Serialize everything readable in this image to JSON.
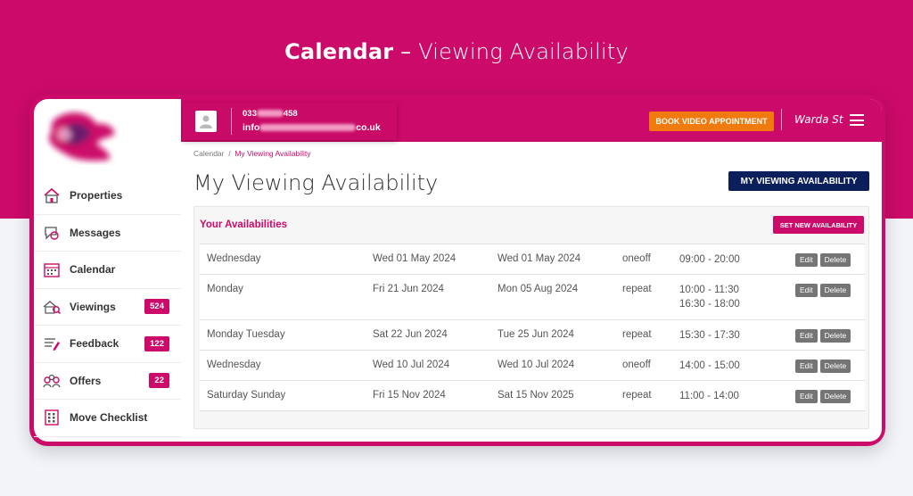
{
  "hero": {
    "title_bold": "Calendar",
    "title_sep": " – ",
    "title_light": "Viewing Availability"
  },
  "colors": {
    "brand": "#cc0a69",
    "navy": "#0b1f5c",
    "orange": "#f07a0c",
    "action_grey": "#757575"
  },
  "sidebar": {
    "items": [
      {
        "label": "Properties",
        "icon": "properties-icon",
        "badge": null
      },
      {
        "label": "Messages",
        "icon": "messages-icon",
        "badge": null
      },
      {
        "label": "Calendar",
        "icon": "calendar-icon",
        "badge": null
      },
      {
        "label": "Viewings",
        "icon": "viewings-icon",
        "badge": "524"
      },
      {
        "label": "Feedback",
        "icon": "feedback-icon",
        "badge": "122"
      },
      {
        "label": "Offers",
        "icon": "offers-icon",
        "badge": "22"
      },
      {
        "label": "Move Checklist",
        "icon": "checklist-icon",
        "badge": null
      }
    ]
  },
  "topbar": {
    "phone_prefix": "033",
    "phone_suffix": "458",
    "email_prefix": "info",
    "email_suffix": "co.uk",
    "book_button": "BOOK VIDEO APPOINTMENT",
    "user_name": "Warda St"
  },
  "breadcrumb": {
    "root": "Calendar",
    "sep": "/",
    "current": "My Viewing Availability"
  },
  "page": {
    "title": "My Viewing Availability",
    "header_button": "MY VIEWING AVAILABILITY"
  },
  "panel": {
    "title": "Your Availabilities",
    "set_button": "SET NEW AVAILABILITY"
  },
  "actions": {
    "edit": "Edit",
    "delete": "Delete"
  },
  "availabilities": [
    {
      "days": "Wednesday",
      "from": "Wed 01 May 2024",
      "to": "Wed 01 May 2024",
      "type": "oneoff",
      "times": [
        "09:00 - 20:00"
      ]
    },
    {
      "days": "Monday",
      "from": "Fri 21 Jun 2024",
      "to": "Mon 05 Aug 2024",
      "type": "repeat",
      "times": [
        "10:00 - 11:30",
        "16:30 - 18:00"
      ]
    },
    {
      "days": "Monday Tuesday",
      "from": "Sat 22 Jun 2024",
      "to": "Tue 25 Jun 2024",
      "type": "repeat",
      "times": [
        "15:30 - 17:30"
      ]
    },
    {
      "days": "Wednesday",
      "from": "Wed 10 Jul 2024",
      "to": "Wed 10 Jul 2024",
      "type": "oneoff",
      "times": [
        "14:00 - 15:00"
      ]
    },
    {
      "days": "Saturday Sunday",
      "from": "Fri 15 Nov 2024",
      "to": "Sat 15 Nov 2025",
      "type": "repeat",
      "times": [
        "11:00 - 14:00"
      ]
    }
  ]
}
